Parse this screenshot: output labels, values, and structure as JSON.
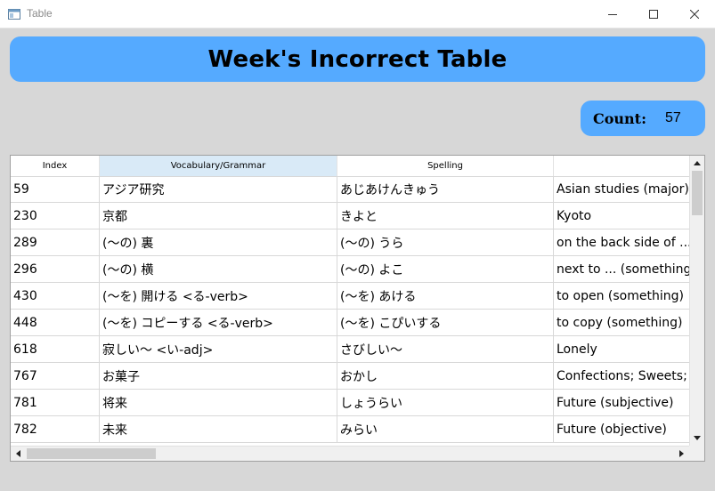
{
  "window": {
    "title": "Table",
    "icon": "app-window-icon"
  },
  "header": {
    "title": "Week's Incorrect Table"
  },
  "count": {
    "label": "Count:",
    "value": "57"
  },
  "colors": {
    "accent": "#55aaff",
    "background": "#d7d7d7",
    "header_selected": "#d9eaf7"
  },
  "table": {
    "columns": [
      "Index",
      "Vocabulary/Grammar",
      "Spelling",
      ""
    ],
    "selected_column": 1,
    "rows": [
      [
        "59",
        "アジア研究",
        "あじあけんきゅう",
        "Asian studies (major)"
      ],
      [
        "230",
        "京都",
        "きよと",
        "Kyoto"
      ],
      [
        "289",
        "(〜の) 裏",
        "(〜の) うら",
        "on the back side of ... ("
      ],
      [
        "296",
        "(〜の) 横",
        "(〜の) よこ",
        "next to ... (something)"
      ],
      [
        "430",
        "(〜を) 開ける <る-verb>",
        "(〜を) あける",
        "to open (something)"
      ],
      [
        "448",
        "(〜を) コピーする <る-verb>",
        "(〜を) こぴいする",
        "to copy (something)"
      ],
      [
        "618",
        "寂しい〜 <い-adj>",
        "さびしい〜",
        "Lonely"
      ],
      [
        "767",
        "お菓子",
        "おかし",
        "Confections; Sweets; S"
      ],
      [
        "781",
        "将来",
        "しょうらい",
        "Future (subjective)"
      ],
      [
        "782",
        "未来",
        "みらい",
        "Future (objective)"
      ]
    ]
  }
}
